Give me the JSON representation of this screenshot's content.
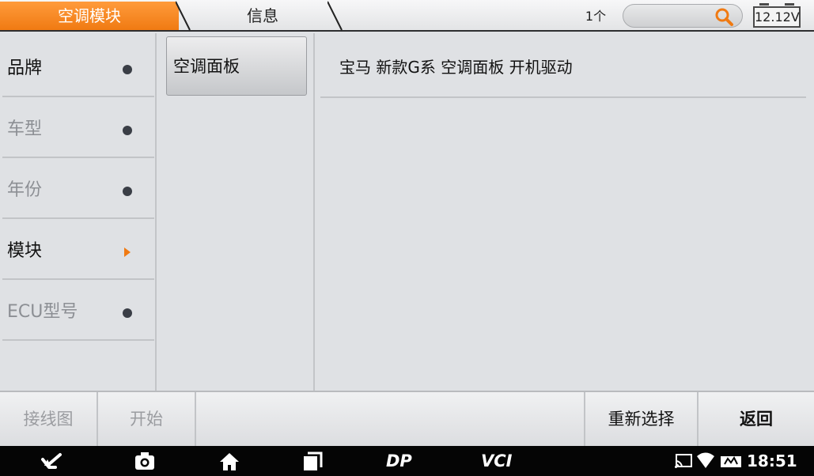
{
  "tabs": [
    {
      "label": "空调模块",
      "active": true
    },
    {
      "label": "信息",
      "active": false
    }
  ],
  "header": {
    "count": "1个",
    "search_placeholder": "",
    "battery_voltage": "12.12V"
  },
  "left_nav": {
    "items": [
      {
        "label": "品牌",
        "state": "selected",
        "marker": "dot"
      },
      {
        "label": "车型",
        "state": "disabled",
        "marker": "dot"
      },
      {
        "label": "年份",
        "state": "disabled",
        "marker": "dot"
      },
      {
        "label": "模块",
        "state": "current",
        "marker": "arrow"
      },
      {
        "label": "ECU型号",
        "state": "disabled",
        "marker": "dot"
      }
    ]
  },
  "middle_list": {
    "items": [
      {
        "label": "空调面板",
        "selected": true
      }
    ]
  },
  "content": {
    "rows": [
      {
        "text": "宝马 新款G系 空调面板 开机驱动"
      }
    ]
  },
  "actions": {
    "wiring": "接线图",
    "start": "开始",
    "reselect": "重新选择",
    "back": "返回"
  },
  "system_bar": {
    "brand_dp": "DP",
    "brand_vci": "VCI",
    "time": "18:51"
  },
  "colors": {
    "accent": "#f07a12",
    "background": "#dfe1e4",
    "active_text": "#111111",
    "disabled_text": "#8c8f94"
  }
}
